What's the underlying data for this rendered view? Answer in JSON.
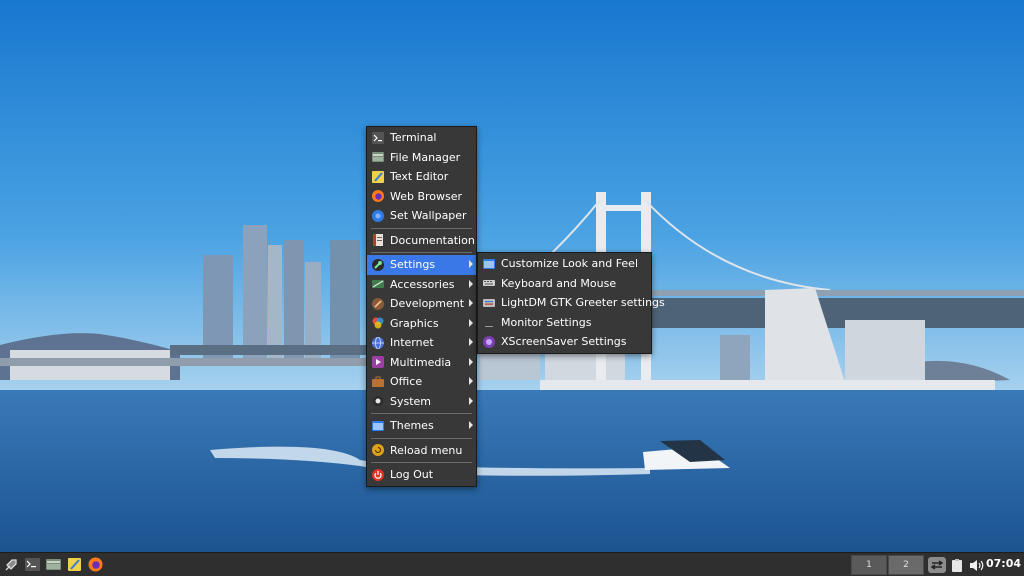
{
  "main_menu": {
    "items": [
      {
        "label": "Terminal",
        "icon": "terminal-icon"
      },
      {
        "label": "File Manager",
        "icon": "file-manager-icon"
      },
      {
        "label": "Text Editor",
        "icon": "text-editor-icon"
      },
      {
        "label": "Web Browser",
        "icon": "firefox-icon"
      },
      {
        "label": "Set Wallpaper",
        "icon": "wallpaper-icon"
      },
      {
        "label": "Documentation",
        "icon": "documentation-icon"
      },
      {
        "label": "Settings",
        "icon": "settings-icon"
      },
      {
        "label": "Accessories",
        "icon": "accessories-icon"
      },
      {
        "label": "Development",
        "icon": "development-icon"
      },
      {
        "label": "Graphics",
        "icon": "graphics-icon"
      },
      {
        "label": "Internet",
        "icon": "internet-icon"
      },
      {
        "label": "Multimedia",
        "icon": "multimedia-icon"
      },
      {
        "label": "Office",
        "icon": "office-icon"
      },
      {
        "label": "System",
        "icon": "system-icon"
      },
      {
        "label": "Themes",
        "icon": "themes-icon"
      },
      {
        "label": "Reload menu",
        "icon": "reload-icon"
      },
      {
        "label": "Log Out",
        "icon": "logout-icon"
      }
    ]
  },
  "settings_submenu": {
    "items": [
      {
        "label": "Customize Look and Feel",
        "icon": "customize-icon"
      },
      {
        "label": "Keyboard and Mouse",
        "icon": "keyboard-icon"
      },
      {
        "label": "LightDM GTK Greeter settings",
        "icon": "lightdm-icon"
      },
      {
        "label": "Monitor Settings",
        "icon": "monitor-icon"
      },
      {
        "label": "XScreenSaver Settings",
        "icon": "screensaver-icon"
      }
    ]
  },
  "taskbar": {
    "launchers": [
      "start-menu-icon",
      "terminal-icon",
      "file-manager-icon",
      "text-editor-icon",
      "firefox-icon"
    ],
    "workspaces": [
      "1",
      "2"
    ],
    "tray": [
      "network-icon",
      "clipboard-icon",
      "volume-icon"
    ],
    "clock": "07:04"
  },
  "colors": {
    "menu_bg": "#383838",
    "highlight": "#3b78e7",
    "taskbar_bg": "#2f2f2f",
    "sky": "#1f86d6",
    "sea": "#2b66a8"
  }
}
